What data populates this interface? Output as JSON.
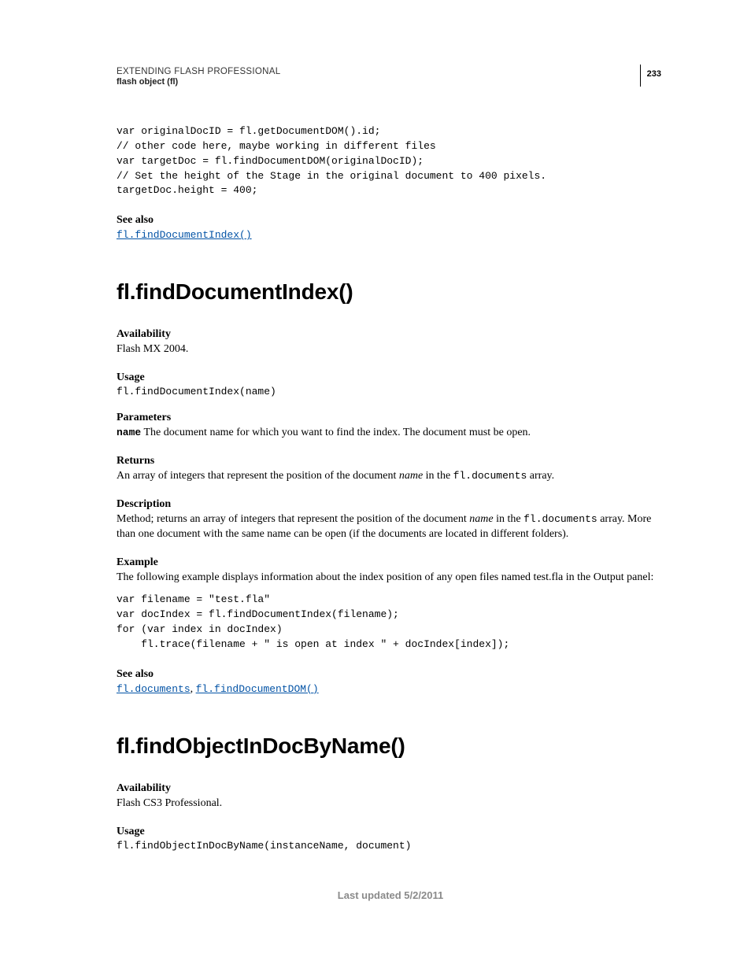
{
  "header": {
    "title": "EXTENDING FLASH PROFESSIONAL",
    "subtitle": "flash object (fl)",
    "page_number": "233"
  },
  "intro_code": "var originalDocID = fl.getDocumentDOM().id;\n// other code here, maybe working in different files\nvar targetDoc = fl.findDocumentDOM(originalDocID);\n// Set the height of the Stage in the original document to 400 pixels.\ntargetDoc.height = 400;",
  "intro_see_also": {
    "label": "See also",
    "link": "fl.findDocumentIndex()"
  },
  "section1": {
    "heading": "fl.findDocumentIndex()",
    "availability_label": "Availability",
    "availability_text": "Flash MX 2004.",
    "usage_label": "Usage",
    "usage_code": "fl.findDocumentIndex(name)",
    "parameters_label": "Parameters",
    "param_name": "name",
    "param_text": "  The document name for which you want to find the index. The document must be open.",
    "returns_label": "Returns",
    "returns_pre": "An array of integers that represent the position of the document ",
    "returns_term": "name",
    "returns_mid": " in the ",
    "returns_code": "fl.documents",
    "returns_post": " array.",
    "description_label": "Description",
    "description_pre": "Method; returns an array of integers that represent the position of the document ",
    "description_term": "name",
    "description_mid": " in the ",
    "description_code": "fl.documents",
    "description_post": " array. More than one document with the same name can be open (if the documents are located in different folders).",
    "example_label": "Example",
    "example_intro": "The following example displays information about the index position of any open files named test.fla in the Output panel:",
    "example_code": "var filename = \"test.fla\"\nvar docIndex = fl.findDocumentIndex(filename);\nfor (var index in docIndex)\n    fl.trace(filename + \" is open at index \" + docIndex[index]);",
    "see_also_label": "See also",
    "see_also_link1": "fl.documents",
    "see_also_sep": ", ",
    "see_also_link2": "fl.findDocumentDOM()"
  },
  "section2": {
    "heading": "fl.findObjectInDocByName()",
    "availability_label": "Availability",
    "availability_text": "Flash CS3 Professional.",
    "usage_label": "Usage",
    "usage_code": "fl.findObjectInDocByName(instanceName, document)"
  },
  "footer": "Last updated 5/2/2011"
}
